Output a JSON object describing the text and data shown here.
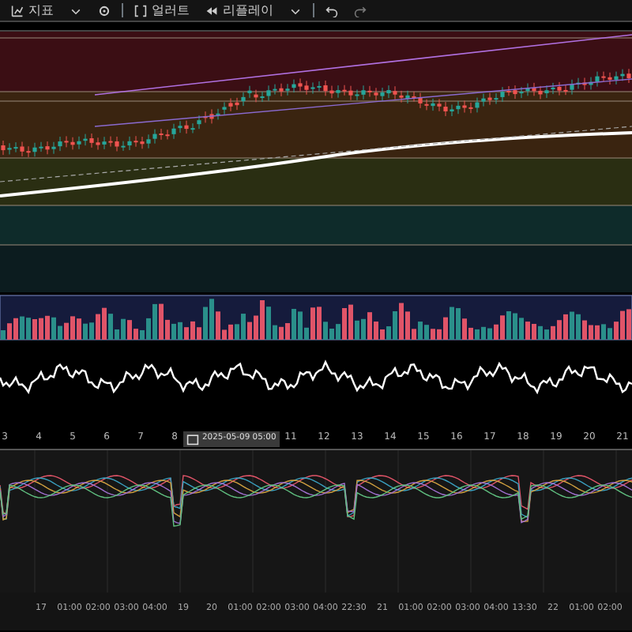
{
  "toolbar": {
    "indicators_label": "지표",
    "alerts_label": "얼러트",
    "replay_label": "리플레이"
  },
  "date_axis": {
    "labels_before": [
      "3",
      "4",
      "5",
      "6",
      "7",
      "8"
    ],
    "crosshair_label": "2025-05-09  05:00",
    "labels_after": [
      "11",
      "12",
      "13",
      "14",
      "15",
      "16",
      "17",
      "18",
      "19",
      "20",
      "21"
    ]
  },
  "time_axis": {
    "labels": [
      "17",
      "01:00",
      "02:00",
      "03:00",
      "04:00",
      "19",
      "20",
      "01:00",
      "02:00",
      "03:00",
      "04:00",
      "22:30",
      "21",
      "01:00",
      "02:00",
      "03:00",
      "04:00",
      "13:30",
      "22",
      "01:00",
      "02:00"
    ]
  }
}
